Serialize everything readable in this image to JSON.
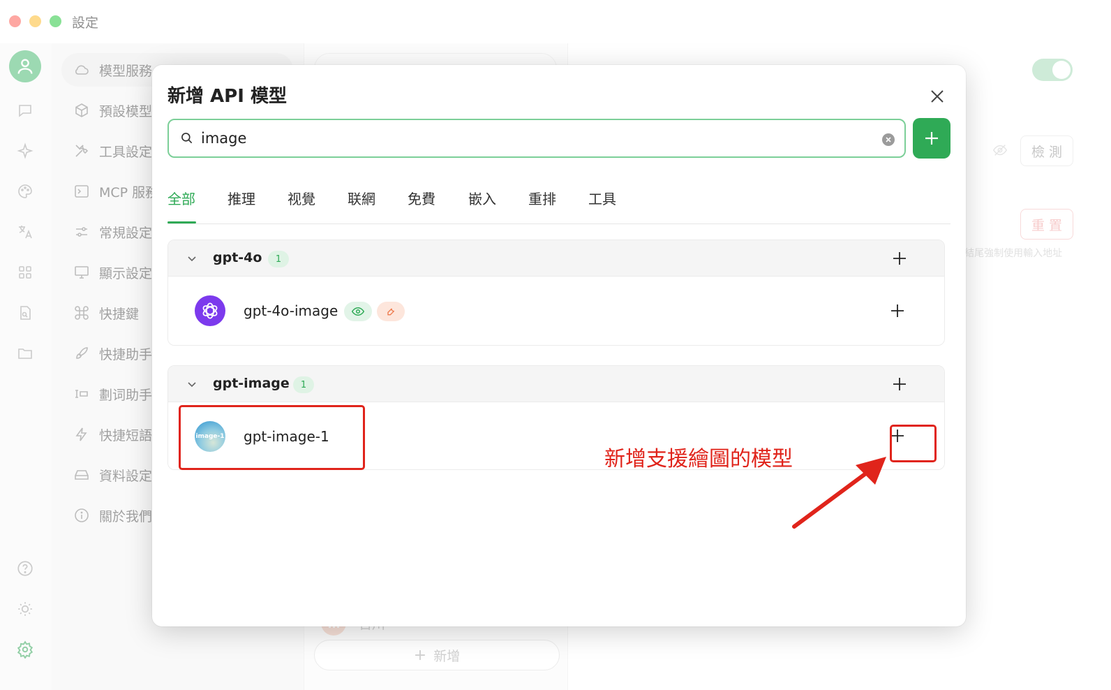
{
  "window": {
    "title": "設定"
  },
  "rail": {
    "icons": [
      "avatar-icon",
      "chat-icon",
      "sparkle-icon",
      "palette-icon",
      "translate-icon",
      "apps-icon",
      "doc-search-icon",
      "folder-icon",
      "help-icon",
      "theme-icon",
      "gear-icon"
    ]
  },
  "menu": {
    "items": [
      {
        "label": "模型服務",
        "icon": "cloud-icon"
      },
      {
        "label": "預設模型",
        "icon": "cube-icon"
      },
      {
        "label": "工具設定",
        "icon": "tools-icon"
      },
      {
        "label": "MCP 服務",
        "icon": "terminal-icon"
      },
      {
        "label": "常規設定",
        "icon": "sliders-icon"
      },
      {
        "label": "顯示設定",
        "icon": "monitor-icon"
      },
      {
        "label": "快捷鍵",
        "icon": "command-icon"
      },
      {
        "label": "快捷助手",
        "icon": "rocket-icon"
      },
      {
        "label": "劃词助手",
        "icon": "text-select-icon"
      },
      {
        "label": "快捷短語",
        "icon": "zap-icon"
      },
      {
        "label": "資料設定",
        "icon": "drive-icon"
      },
      {
        "label": "關於我們",
        "icon": "info-icon"
      }
    ]
  },
  "provider_list": {
    "visible_provider": "百川",
    "add_label": "新增"
  },
  "detail": {
    "detect_label": "檢 測",
    "reset_label": "重 置",
    "hint": "# 結尾強制使用輸入地址"
  },
  "modal": {
    "title": "新增 API 模型",
    "search_value": "image",
    "tabs": [
      "全部",
      "推理",
      "视覺",
      "联網",
      "免費",
      "嵌入",
      "重排",
      "工具"
    ],
    "active_tab": "全部",
    "groups": [
      {
        "name": "gpt-4o",
        "count": "1",
        "models": [
          {
            "name": "gpt-4o-image",
            "logo": "openai-icon",
            "capabilities": [
              "eye-icon",
              "wrench-icon"
            ]
          }
        ]
      },
      {
        "name": "gpt-image",
        "count": "1",
        "models": [
          {
            "name": "gpt-image-1",
            "logo": "image-1-icon",
            "logo_text": "image-1",
            "capabilities": []
          }
        ]
      }
    ]
  },
  "annotation": {
    "text": "新增支援繪圖的模型",
    "color": "#e0241b"
  },
  "colors": {
    "accent": "#2faa56",
    "annotation": "#e0241b"
  }
}
